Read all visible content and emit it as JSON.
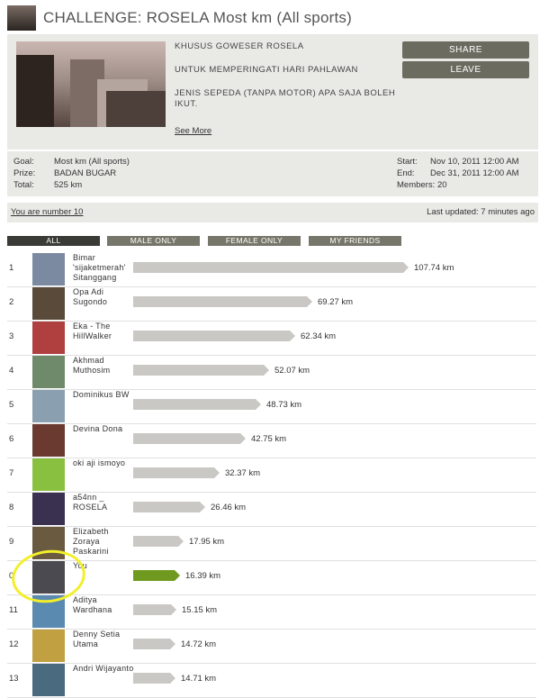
{
  "header": {
    "title": "CHALLENGE:  ROSELA Most km (All sports)"
  },
  "description": {
    "line1": "KHUSUS GOWESER ROSELA",
    "line2": "UNTUK MEMPERINGATI HARI PAHLAWAN",
    "line3": "JENIS SEPEDA (TANPA MOTOR) APA SAJA BOLEH IKUT.",
    "see_more": "See More"
  },
  "actions": {
    "share": "SHARE",
    "leave": "LEAVE"
  },
  "stats": {
    "goal_label": "Goal:",
    "goal": "Most km (All sports)",
    "prize_label": "Prize:",
    "prize": "BADAN BUGAR",
    "total_label": "Total:",
    "total": "525 km",
    "start_label": "Start:",
    "start": "Nov 10, 2011 12:00 AM",
    "end_label": "End:",
    "end": "Dec 31, 2011 12:00 AM",
    "members_label": "Members:",
    "members": "20"
  },
  "rank": {
    "you_are": "You are number 10",
    "last_updated": "Last updated: 7 minutes ago"
  },
  "tabs": [
    "ALL",
    "MALE ONLY",
    "FEMALE ONLY",
    "MY FRIENDS"
  ],
  "leaderboard": [
    {
      "num": "1",
      "name": "Bimar 'sijaketmerah' Sitanggang",
      "km": "107.74 km",
      "value": 107.74,
      "avatar": "#7b8aa0"
    },
    {
      "num": "2",
      "name": "Opa Adi Sugondo",
      "km": "69.27 km",
      "value": 69.27,
      "avatar": "#5a4a3a"
    },
    {
      "num": "3",
      "name": "Eka - The HillWalker",
      "km": "62.34 km",
      "value": 62.34,
      "avatar": "#b04040"
    },
    {
      "num": "4",
      "name": "Akhmad Muthosim",
      "km": "52.07 km",
      "value": 52.07,
      "avatar": "#6f8a6a"
    },
    {
      "num": "5",
      "name": "Dominikus BW",
      "km": "48.73 km",
      "value": 48.73,
      "avatar": "#8aa0b0"
    },
    {
      "num": "6",
      "name": "Devina Dona",
      "km": "42.75 km",
      "value": 42.75,
      "avatar": "#6a3a30"
    },
    {
      "num": "7",
      "name": "oki aji ismoyo",
      "km": "32.37 km",
      "value": 32.37,
      "avatar": "#8ac040"
    },
    {
      "num": "8",
      "name": "a54nn _ ROSELA",
      "km": "26.46 km",
      "value": 26.46,
      "avatar": "#3a3050"
    },
    {
      "num": "9",
      "name": "Elizabeth Zoraya Paskarini",
      "km": "17.95 km",
      "value": 17.95,
      "avatar": "#6a5a40"
    },
    {
      "num": "0",
      "name": "You",
      "km": "16.39 km",
      "value": 16.39,
      "avatar": "#4a4a50",
      "you": true
    },
    {
      "num": "11",
      "name": "Aditya Wardhana",
      "km": "15.15 km",
      "value": 15.15,
      "avatar": "#5a8ab0"
    },
    {
      "num": "12",
      "name": "Denny Setia Utama",
      "km": "14.72 km",
      "value": 14.72,
      "avatar": "#c0a040"
    },
    {
      "num": "13",
      "name": "Andri Wijayanto",
      "km": "14.71 km",
      "value": 14.71,
      "avatar": "#4a6a80"
    }
  ]
}
